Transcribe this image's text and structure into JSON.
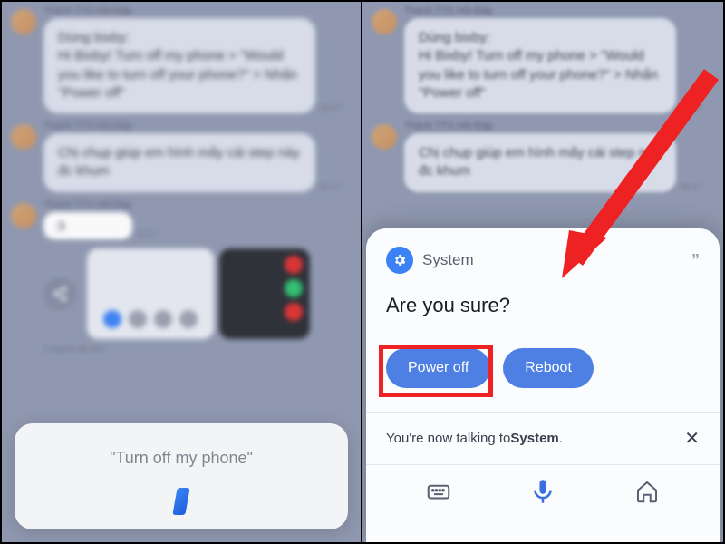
{
  "chat": {
    "sender": "Thành TTS Hỏi Đáp",
    "msg1": "Dùng bixby:\nHi Bixby! Turn off my phone > \"Would you like to turn off your phone?\" > Nhấn \"Power off\"",
    "msg2": "Chị chụp giúp em hình mấy cái step này đc khum",
    "msg3": ":3",
    "time1": "15:17",
    "time2": "15:17",
    "time3": "15:17",
    "viewers": "3 người đã đọc"
  },
  "bixby": {
    "command": "\"Turn off my phone\""
  },
  "system_card": {
    "badge_label": "System",
    "prompt": "Are you sure?",
    "power_off": "Power off",
    "reboot": "Reboot",
    "talking_prefix": "You're now talking to ",
    "talking_target": "System",
    "talking_suffix": "."
  }
}
